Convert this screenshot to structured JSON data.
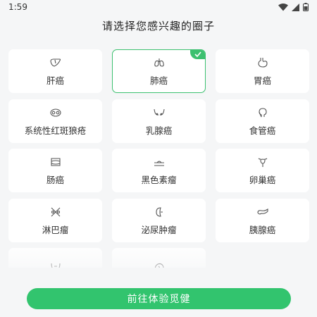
{
  "status_bar": {
    "time": "1:59"
  },
  "page": {
    "title": "请选择您感兴趣的圈子"
  },
  "colors": {
    "accent": "#32c46e",
    "card": "#ffffff",
    "background": "#f5f6f7"
  },
  "circles": [
    {
      "label": "肝癌",
      "icon": "liver-icon",
      "selected": false
    },
    {
      "label": "肺癌",
      "icon": "lungs-icon",
      "selected": true
    },
    {
      "label": "胃癌",
      "icon": "stomach-icon",
      "selected": false
    },
    {
      "label": "系统性红斑狼疮",
      "icon": "lupus-icon",
      "selected": false
    },
    {
      "label": "乳腺癌",
      "icon": "breast-icon",
      "selected": false
    },
    {
      "label": "食管癌",
      "icon": "esophagus-icon",
      "selected": false
    },
    {
      "label": "肠癌",
      "icon": "intestine-icon",
      "selected": false
    },
    {
      "label": "黑色素瘤",
      "icon": "skin-icon",
      "selected": false
    },
    {
      "label": "卵巢癌",
      "icon": "uterus-icon",
      "selected": false
    },
    {
      "label": "淋巴瘤",
      "icon": "lymph-icon",
      "selected": false
    },
    {
      "label": "泌尿肿瘤",
      "icon": "kidney-icon",
      "selected": false
    },
    {
      "label": "胰腺癌",
      "icon": "pancreas-icon",
      "selected": false
    },
    {
      "label": "",
      "icon": "pelvis-icon",
      "selected": false
    },
    {
      "label": "",
      "icon": "brain-icon",
      "selected": false
    }
  ],
  "cta": {
    "label": "前往体验觅健"
  }
}
